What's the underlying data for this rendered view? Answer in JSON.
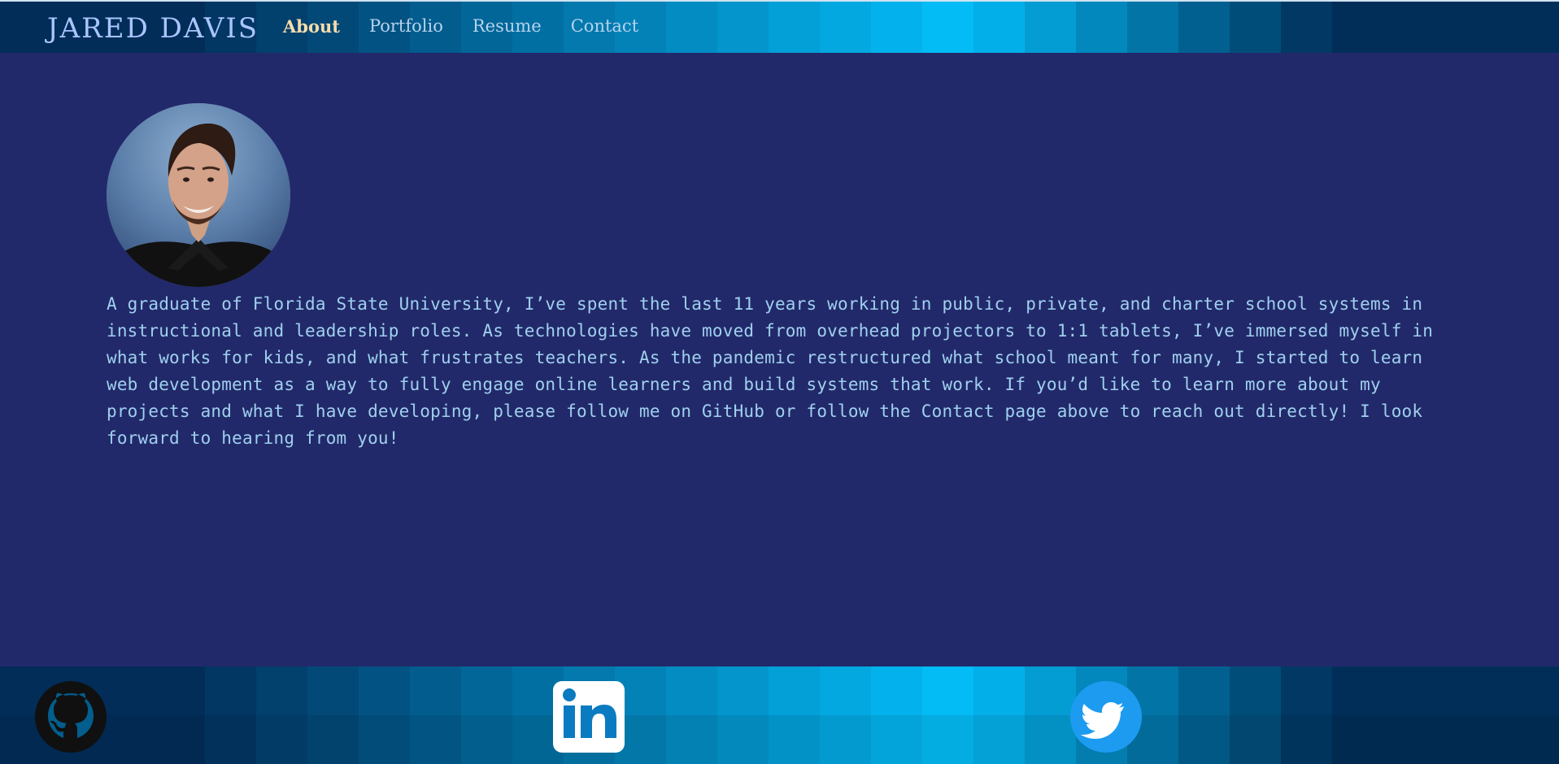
{
  "header": {
    "brand": "JARED DAVIS",
    "nav": [
      {
        "label": "About",
        "active": true
      },
      {
        "label": "Portfolio",
        "active": false
      },
      {
        "label": "Resume",
        "active": false
      },
      {
        "label": "Contact",
        "active": false
      }
    ]
  },
  "about": {
    "bio": "A graduate of Florida State University, I’ve spent the last 11 years working in public, private, and charter school systems in instructional and leadership roles. As technologies have moved from overhead projectors to 1:1 tablets, I’ve immersed myself in what works for kids, and what frustrates teachers. As the pandemic restructured what school meant for many, I started to learn web development as a way to fully engage online learners and build systems that work. If you’d like to learn more about my projects and what I have developing, please follow me on GitHub or follow the Contact page above to reach out directly! I look forward to hearing from you!"
  },
  "footer": {
    "icons": [
      "github-icon",
      "linkedin-icon",
      "twitter-icon"
    ]
  },
  "colors": {
    "page_bg": "#22296a",
    "header_gradient_start": "#022d59",
    "header_gradient_mid": "#03bef9",
    "header_gradient_end": "#012e58",
    "nav_active": "#f6dcaa",
    "nav_text": "#b7d3ee",
    "bio_text": "#9fd0ee",
    "brand_text": "#a9c5ff"
  }
}
